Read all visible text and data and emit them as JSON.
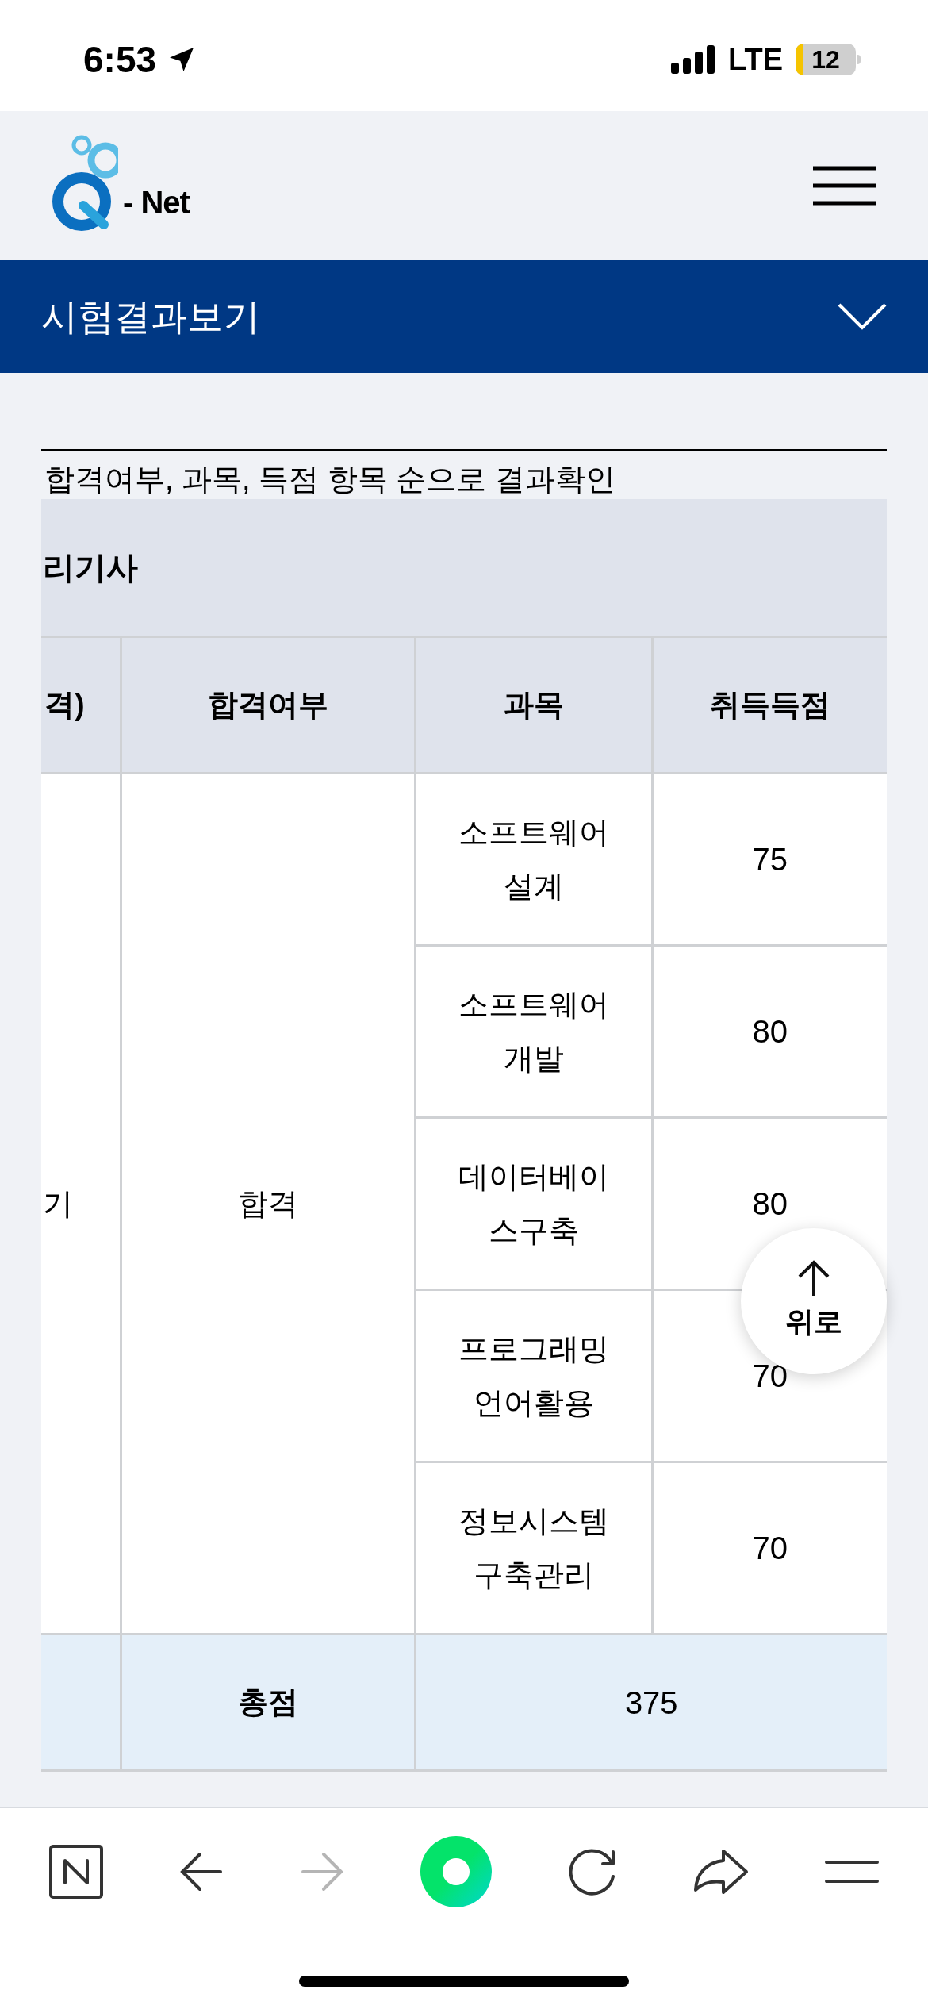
{
  "status_bar": {
    "time": "6:53",
    "network": "LTE",
    "battery": "12"
  },
  "header": {
    "logo_text": "- Net"
  },
  "section_bar": {
    "title": "시험결과보기",
    "expanded": false
  },
  "description": "합격여부, 과목, 득점 항목 순으로 결과확인",
  "table": {
    "title": "리기사",
    "columns": [
      "격)",
      "합격여부",
      "과목",
      "취득득점"
    ],
    "row_label": "기",
    "result": "합격",
    "subjects": [
      {
        "subject": "소프트웨어 설계",
        "score": "75"
      },
      {
        "subject": "소프트웨어 개발",
        "score": "80"
      },
      {
        "subject": "데이터베이스구축",
        "score": "80"
      },
      {
        "subject": "프로그래밍 언어활용",
        "score": "70"
      },
      {
        "subject": "정보시스템 구축관리",
        "score": "70"
      }
    ],
    "total": {
      "label": "총점",
      "value": "375"
    }
  },
  "scroll_top_button": {
    "label": "위로"
  },
  "browser_toolbar": {
    "forward_disabled": true
  }
}
